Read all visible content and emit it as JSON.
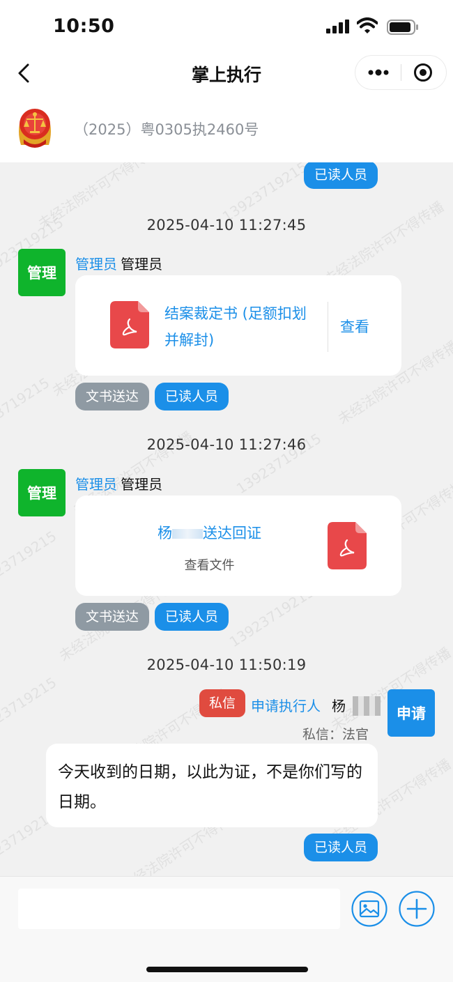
{
  "status_bar": {
    "time": "10:50"
  },
  "nav": {
    "title": "掌上执行"
  },
  "case": {
    "number": "（2025）粤0305执2460号"
  },
  "watermark": {
    "text": "未经法院许可不得传播",
    "phone": "13923719215",
    "name": "杨"
  },
  "chat": {
    "top_read_label": "已读人员",
    "messages": [
      {
        "timestamp": "2025-04-10 11:27:45",
        "avatar": "管理",
        "sender_role": "管理员",
        "sender_name": "管理员",
        "card_title": "结案裁定书 (足额扣划并解封)",
        "card_action": "查看",
        "tag": "文书送达",
        "read_label": "已读人员"
      },
      {
        "timestamp": "2025-04-10 11:27:46",
        "avatar": "管理",
        "sender_role": "管理员",
        "sender_name": "管理员",
        "card_title_a": "杨",
        "card_title_b": "送达回证",
        "card_sub": "查看文件",
        "tag": "文书送达",
        "read_label": "已读人员"
      },
      {
        "timestamp": "2025-04-10 11:50:19",
        "avatar": "申请",
        "private_badge": "私信",
        "sender_role": "申请执行人",
        "sender_name": "杨",
        "private_to": "私信：法官",
        "text": "今天收到的日期，以此为证，不是你们写的日期。",
        "read_label": "已读人员"
      }
    ]
  },
  "input": {
    "placeholder": ""
  },
  "colors": {
    "accent": "#1b8fe8",
    "green": "#0fb42c",
    "red": "#e04b3f",
    "gray_tag": "#8f9aa3",
    "pdf": "#e8484a"
  },
  "icons": [
    "back-icon",
    "more-icon",
    "target-icon",
    "court-emblem-icon",
    "pdf-icon",
    "image-icon",
    "plus-icon"
  ]
}
